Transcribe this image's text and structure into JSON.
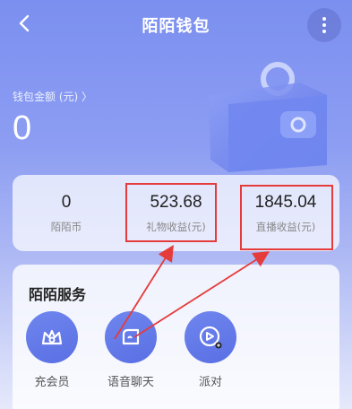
{
  "header": {
    "title": "陌陌钱包",
    "back_icon": "back-chevron-icon",
    "more_icon": "more-vertical-icon"
  },
  "balance": {
    "label": "钱包金额 (元) 〉",
    "value": "0"
  },
  "stats": [
    {
      "value": "0",
      "label": "陌陌币"
    },
    {
      "value": "523.68",
      "label": "礼物收益(元)"
    },
    {
      "value": "1845.04",
      "label": "直播收益(元)"
    }
  ],
  "services": {
    "title": "陌陌服务",
    "items": [
      {
        "label": "充会员",
        "icon": "crown-icon"
      },
      {
        "label": "语音聊天",
        "icon": "voice-chat-icon"
      },
      {
        "label": "派对",
        "icon": "party-icon"
      }
    ]
  },
  "colors": {
    "accent": "#6f86ee",
    "highlight": "#e53b3b"
  }
}
